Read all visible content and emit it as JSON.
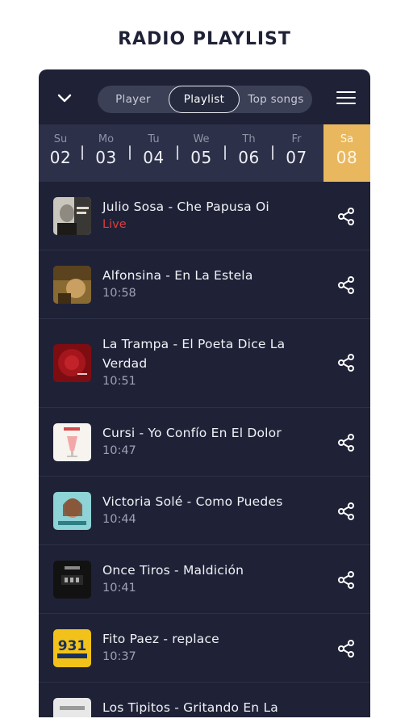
{
  "page": {
    "title": "RADIO PLAYLIST"
  },
  "tabs": {
    "player": "Player",
    "playlist": "Playlist",
    "top_songs": "Top songs"
  },
  "days": [
    {
      "name": "Su",
      "date": "02"
    },
    {
      "name": "Mo",
      "date": "03"
    },
    {
      "name": "Tu",
      "date": "04"
    },
    {
      "name": "We",
      "date": "05"
    },
    {
      "name": "Th",
      "date": "06"
    },
    {
      "name": "Fr",
      "date": "07"
    },
    {
      "name": "Sa",
      "date": "08"
    }
  ],
  "songs": [
    {
      "title": "Julio Sosa - Che Papusa Oi",
      "time": "Live"
    },
    {
      "title": "Alfonsina - En La Estela",
      "time": "10:58"
    },
    {
      "title": "La Trampa - El Poeta Dice La Verdad",
      "time": "10:51"
    },
    {
      "title": "Cursi - Yo Confío En El Dolor",
      "time": "10:47"
    },
    {
      "title": "Victoria Solé - Como Puedes",
      "time": "10:44"
    },
    {
      "title": "Once Tiros - Maldición",
      "time": "10:41"
    },
    {
      "title": "Fito Paez - replace",
      "time": "10:37"
    },
    {
      "title": "Los Tipitos - Gritando En La",
      "time": ""
    }
  ],
  "colors": {
    "background": "#1f2237",
    "accent": "#e9b85e",
    "live": "#e23b3b"
  }
}
